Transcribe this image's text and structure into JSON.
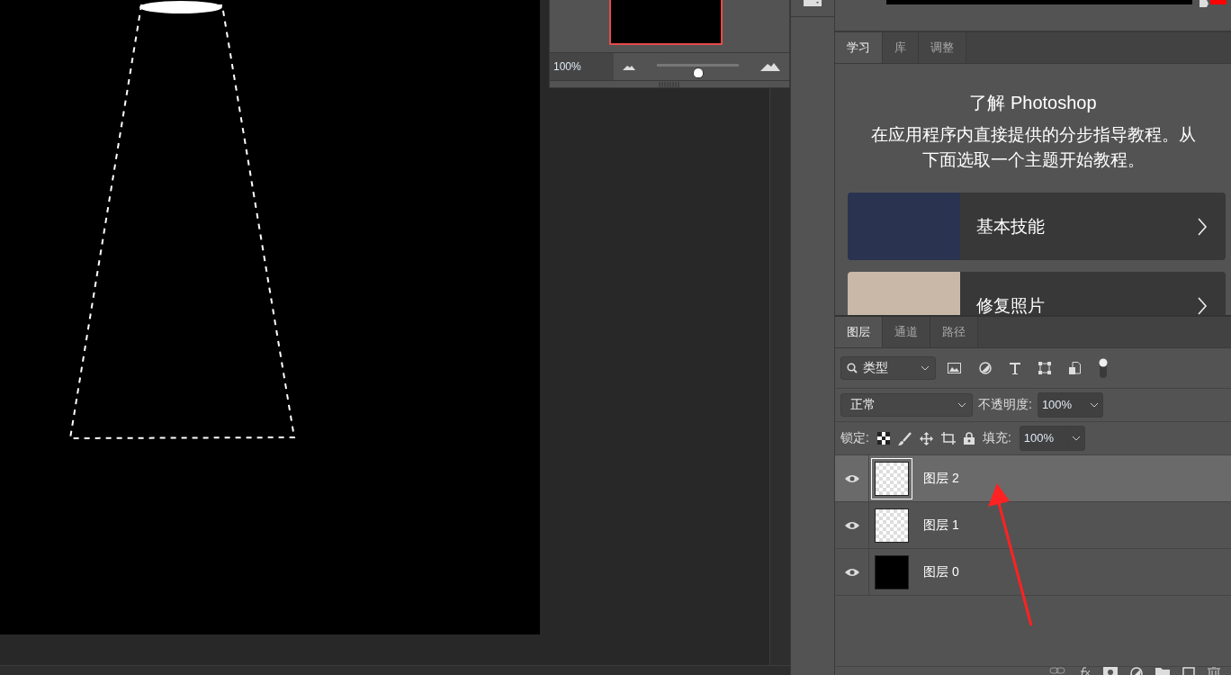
{
  "navigator": {
    "zoom": "100%",
    "level": 0.5
  },
  "learn_panel": {
    "tabs": [
      {
        "label": "学习",
        "selected": true
      },
      {
        "label": "库",
        "selected": false
      },
      {
        "label": "调整",
        "selected": false
      }
    ],
    "title": "了解 Photoshop",
    "description": "在应用程序内直接提供的分步指导教程。从下面选取一个主题开始教程。",
    "topics": [
      {
        "label": "基本技能"
      },
      {
        "label": "修复照片"
      }
    ]
  },
  "layers_panel": {
    "tabs": [
      {
        "label": "图层",
        "selected": true
      },
      {
        "label": "通道",
        "selected": false
      },
      {
        "label": "路径",
        "selected": false
      }
    ],
    "filter": "类型",
    "blend_mode": "正常",
    "opacity_label": "不透明度:",
    "opacity": "100%",
    "lock_label": "锁定:",
    "fill_label": "填充:",
    "fill": "100%",
    "layers": [
      {
        "name": "图层 2",
        "selected": true,
        "visible": true,
        "kind": "transparent"
      },
      {
        "name": "图层 1",
        "selected": false,
        "visible": true,
        "kind": "transparent"
      },
      {
        "name": "图层 0",
        "selected": false,
        "visible": true,
        "kind": "black"
      }
    ]
  }
}
